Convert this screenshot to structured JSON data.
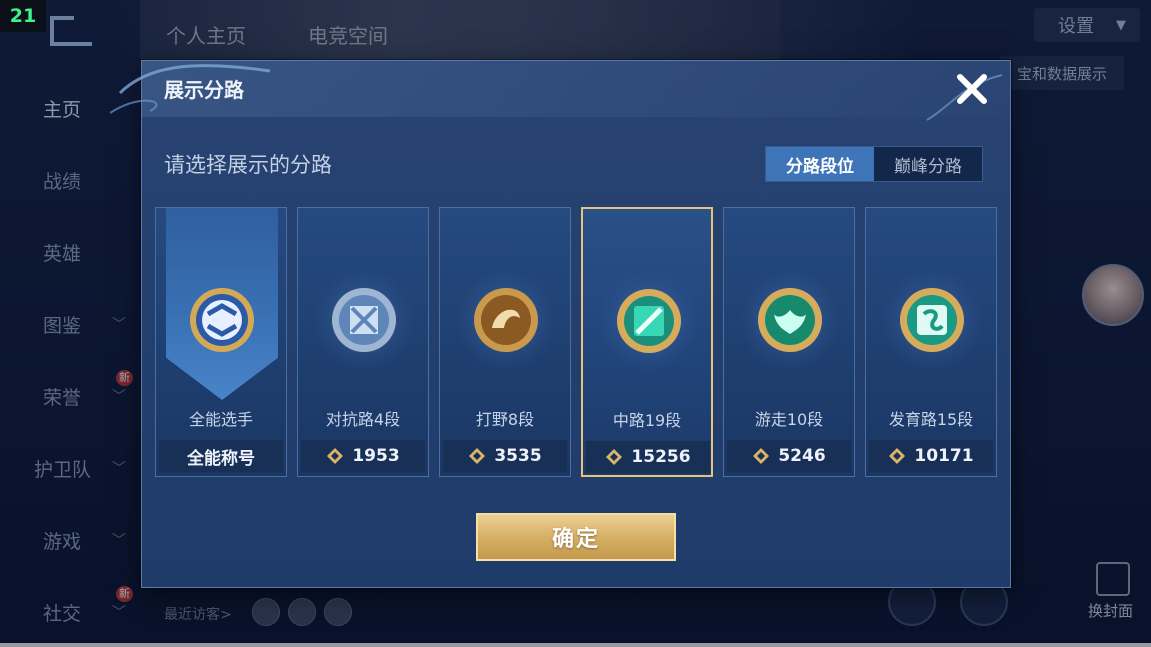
{
  "counter": "21",
  "bg_tabs": [
    "个人主页",
    "电竞空间"
  ],
  "sidebar": {
    "items": [
      {
        "label": "主页",
        "chevron": false,
        "active": true
      },
      {
        "label": "战绩",
        "chevron": false
      },
      {
        "label": "英雄",
        "chevron": false
      },
      {
        "label": "图鉴",
        "chevron": true
      },
      {
        "label": "荣誉",
        "chevron": true,
        "badge": "新"
      },
      {
        "label": "护卫队",
        "chevron": true
      },
      {
        "label": "游戏",
        "chevron": true
      },
      {
        "label": "社交",
        "chevron": true,
        "badge": "新"
      }
    ]
  },
  "settings": {
    "label": "设置"
  },
  "hero_show": {
    "label": "宝和数据展示"
  },
  "visitors": {
    "label": "最近访客>"
  },
  "change_cover": {
    "label": "换封面"
  },
  "dialog": {
    "title": "展示分路",
    "subtitle": "请选择展示的分路",
    "toggle": {
      "options": [
        "分路段位",
        "巅峰分路"
      ],
      "active_index": 0
    },
    "cards": [
      {
        "label": "全能选手",
        "score": "全能称号",
        "show_icon": false,
        "color": "#3a6fc0"
      },
      {
        "label": "对抗路4段",
        "score": "1953",
        "show_icon": true,
        "color": "#8fb0d8"
      },
      {
        "label": "打野8段",
        "score": "3535",
        "show_icon": true,
        "color": "#c8944a"
      },
      {
        "label": "中路19段",
        "score": "15256",
        "show_icon": true,
        "color": "#2fbfa0",
        "selected": true
      },
      {
        "label": "游走10段",
        "score": "5246",
        "show_icon": true,
        "color": "#2fb28c"
      },
      {
        "label": "发育路15段",
        "score": "10171",
        "show_icon": true,
        "color": "#31bfa5"
      }
    ],
    "confirm_label": "确定"
  },
  "colors": {
    "accent_gold": "#e6c27a",
    "toggle_active": "#3e74b8"
  }
}
